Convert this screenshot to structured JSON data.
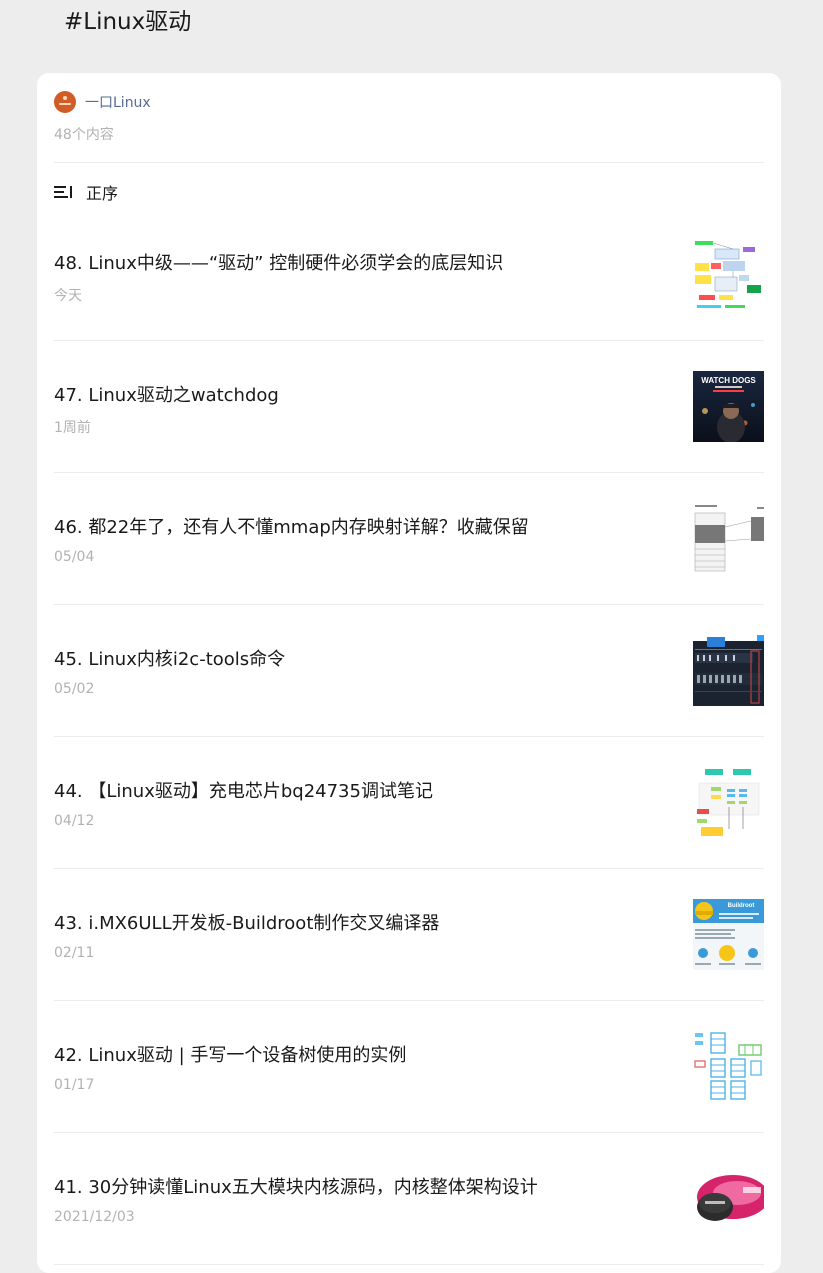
{
  "page": {
    "title": "#Linux驱动"
  },
  "account": {
    "name": "一口Linux",
    "count": "48个内容"
  },
  "sort": {
    "label": "正序"
  },
  "articles": [
    {
      "title": "48. Linux中级——“驱动” 控制硬件必须学会的底层知识",
      "date": "今天",
      "thumb_icon": "diagram-thumbnail"
    },
    {
      "title": "47. Linux驱动之watchdog",
      "date": "1周前",
      "thumb_icon": "game-cover-thumbnail",
      "thumb_text": "WATCH DOGS"
    },
    {
      "title": "46. 都22年了，还有人不懂mmap内存映射详解？收藏保留",
      "date": "05/04",
      "thumb_icon": "memory-diagram-thumbnail"
    },
    {
      "title": "45. Linux内核i2c-tools命令",
      "date": "05/02",
      "thumb_icon": "terminal-thumbnail"
    },
    {
      "title": "44. 【Linux驱动】充电芯片bq24735调试笔记",
      "date": "04/12",
      "thumb_icon": "flowchart-thumbnail"
    },
    {
      "title": "43. i.MX6ULL开发板-Buildroot制作交叉编译器",
      "date": "02/11",
      "thumb_icon": "buildroot-thumbnail",
      "thumb_text": "Buildroot"
    },
    {
      "title": "42. Linux驱动 | 手写一个设备树使用的实例",
      "date": "01/17",
      "thumb_icon": "device-tree-thumbnail"
    },
    {
      "title": "41. 30分钟读懂Linux五大模块内核源码，内核整体架构设计",
      "date": "2021/12/03",
      "thumb_icon": "chip-thumbnail"
    }
  ]
}
